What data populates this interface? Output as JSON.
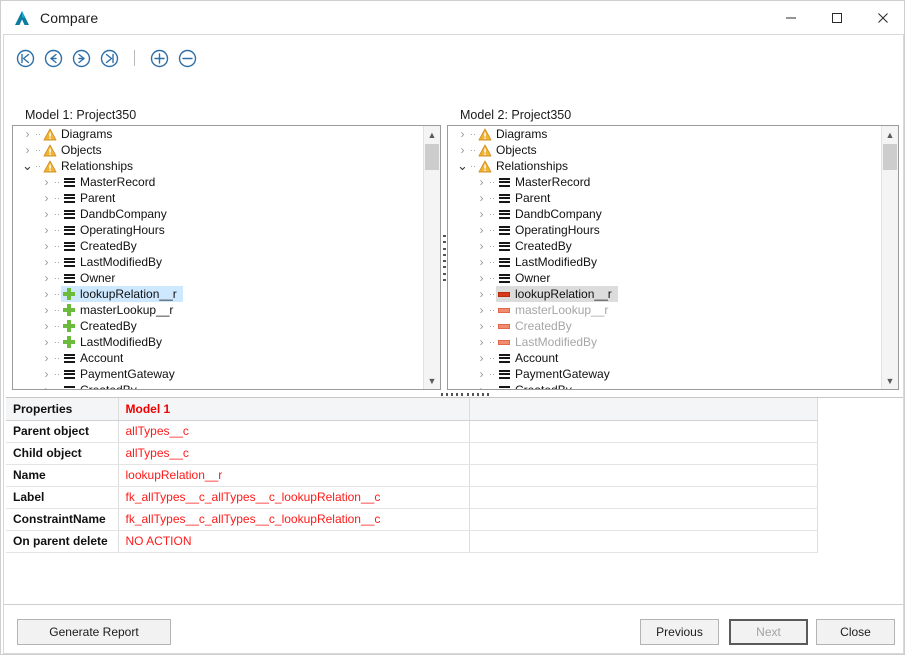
{
  "window": {
    "title": "Compare",
    "logo_icon": "app-logo-icon",
    "minimize_label": "─",
    "maximize_label": "□",
    "close_label": "✕"
  },
  "toolbar": {
    "buttons": [
      {
        "name": "first-icon",
        "glyph": "first"
      },
      {
        "name": "previous-icon",
        "glyph": "prev"
      },
      {
        "name": "next-icon",
        "glyph": "next"
      },
      {
        "name": "last-icon",
        "glyph": "last"
      },
      {
        "name": "expand-all-icon",
        "glyph": "plus"
      },
      {
        "name": "collapse-all-icon",
        "glyph": "minus"
      }
    ]
  },
  "panels": {
    "model1": {
      "label": "Model 1: Project350",
      "rows": [
        {
          "label": "Diagrams",
          "level": 0,
          "icon": "warning",
          "twist": "collapsed",
          "state": "normal"
        },
        {
          "label": "Objects",
          "level": 0,
          "icon": "warning",
          "twist": "collapsed",
          "state": "normal"
        },
        {
          "label": "Relationships",
          "level": 0,
          "icon": "warning",
          "twist": "expanded",
          "state": "normal"
        },
        {
          "label": "MasterRecord",
          "level": 1,
          "icon": "bars",
          "twist": "collapsed",
          "state": "normal"
        },
        {
          "label": "Parent",
          "level": 1,
          "icon": "bars",
          "twist": "collapsed",
          "state": "normal"
        },
        {
          "label": "DandbCompany",
          "level": 1,
          "icon": "bars",
          "twist": "collapsed",
          "state": "normal"
        },
        {
          "label": "OperatingHours",
          "level": 1,
          "icon": "bars",
          "twist": "collapsed",
          "state": "normal"
        },
        {
          "label": "CreatedBy",
          "level": 1,
          "icon": "bars",
          "twist": "collapsed",
          "state": "normal"
        },
        {
          "label": "LastModifiedBy",
          "level": 1,
          "icon": "bars",
          "twist": "collapsed",
          "state": "normal"
        },
        {
          "label": "Owner",
          "level": 1,
          "icon": "bars",
          "twist": "collapsed",
          "state": "normal"
        },
        {
          "label": "lookupRelation__r",
          "level": 1,
          "icon": "plus",
          "twist": "collapsed",
          "state": "selected-blue"
        },
        {
          "label": "masterLookup__r",
          "level": 1,
          "icon": "plus",
          "twist": "collapsed",
          "state": "normal"
        },
        {
          "label": "CreatedBy",
          "level": 1,
          "icon": "plus",
          "twist": "collapsed",
          "state": "normal"
        },
        {
          "label": "LastModifiedBy",
          "level": 1,
          "icon": "plus",
          "twist": "collapsed",
          "state": "normal"
        },
        {
          "label": "Account",
          "level": 1,
          "icon": "bars",
          "twist": "collapsed",
          "state": "normal"
        },
        {
          "label": "PaymentGateway",
          "level": 1,
          "icon": "bars",
          "twist": "collapsed",
          "state": "normal"
        },
        {
          "label": "CreatedBy",
          "level": 1,
          "icon": "bars",
          "twist": "collapsed",
          "state": "normal"
        }
      ]
    },
    "model2": {
      "label": "Model 2: Project350",
      "rows": [
        {
          "label": "Diagrams",
          "level": 0,
          "icon": "warning",
          "twist": "collapsed",
          "state": "normal"
        },
        {
          "label": "Objects",
          "level": 0,
          "icon": "warning",
          "twist": "collapsed",
          "state": "normal"
        },
        {
          "label": "Relationships",
          "level": 0,
          "icon": "warning",
          "twist": "expanded",
          "state": "normal"
        },
        {
          "label": "MasterRecord",
          "level": 1,
          "icon": "bars",
          "twist": "collapsed",
          "state": "normal"
        },
        {
          "label": "Parent",
          "level": 1,
          "icon": "bars",
          "twist": "collapsed",
          "state": "normal"
        },
        {
          "label": "DandbCompany",
          "level": 1,
          "icon": "bars",
          "twist": "collapsed",
          "state": "normal"
        },
        {
          "label": "OperatingHours",
          "level": 1,
          "icon": "bars",
          "twist": "collapsed",
          "state": "normal"
        },
        {
          "label": "CreatedBy",
          "level": 1,
          "icon": "bars",
          "twist": "collapsed",
          "state": "normal"
        },
        {
          "label": "LastModifiedBy",
          "level": 1,
          "icon": "bars",
          "twist": "collapsed",
          "state": "normal"
        },
        {
          "label": "Owner",
          "level": 1,
          "icon": "bars",
          "twist": "collapsed",
          "state": "normal"
        },
        {
          "label": "lookupRelation__r",
          "level": 1,
          "icon": "minus-strong",
          "twist": "collapsed",
          "state": "selected-gray"
        },
        {
          "label": "masterLookup__r",
          "level": 1,
          "icon": "minus",
          "twist": "collapsed",
          "state": "dim"
        },
        {
          "label": "CreatedBy",
          "level": 1,
          "icon": "minus",
          "twist": "collapsed",
          "state": "dim"
        },
        {
          "label": "LastModifiedBy",
          "level": 1,
          "icon": "minus",
          "twist": "collapsed",
          "state": "dim"
        },
        {
          "label": "Account",
          "level": 1,
          "icon": "bars",
          "twist": "collapsed",
          "state": "normal"
        },
        {
          "label": "PaymentGateway",
          "level": 1,
          "icon": "bars",
          "twist": "collapsed",
          "state": "normal"
        },
        {
          "label": "CreatedBy",
          "level": 1,
          "icon": "bars",
          "twist": "collapsed",
          "state": "normal"
        }
      ]
    }
  },
  "properties_table": {
    "headers": [
      "Properties",
      "Model 1",
      ""
    ],
    "rows": [
      {
        "key": "Parent object",
        "value": "allTypes__c"
      },
      {
        "key": "Child object",
        "value": "allTypes__c"
      },
      {
        "key": "Name",
        "value": "lookupRelation__r"
      },
      {
        "key": "Label",
        "value": "fk_allTypes__c_allTypes__c_lookupRelation__c"
      },
      {
        "key": "ConstraintName",
        "value": "fk_allTypes__c_allTypes__c_lookupRelation__c"
      },
      {
        "key": "On parent delete",
        "value": "NO ACTION"
      }
    ]
  },
  "footer": {
    "generate_report_label": "Generate Report",
    "previous_label": "Previous",
    "next_label": "Next",
    "close_label": "Close"
  },
  "colors": {
    "accent_red": "#ff1a1a",
    "header_red": "#ee0000",
    "added_green": "#6cbb3c",
    "removed_red": "#f08a70",
    "warning_orange": "#f0a830",
    "selection_blue": "#cde8ff",
    "selection_gray": "#dcdcdc",
    "toolbar_blue": "#2f6fa8"
  }
}
